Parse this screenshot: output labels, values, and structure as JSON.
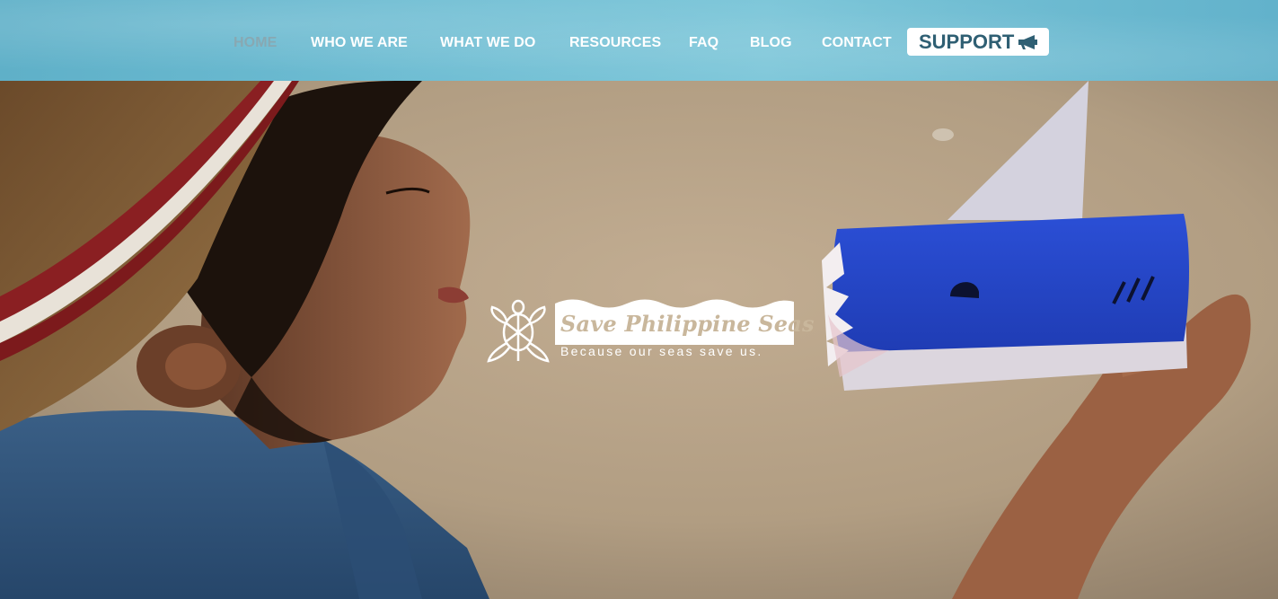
{
  "nav": {
    "items": [
      {
        "label": "HOME",
        "active": true
      },
      {
        "label": "WHO WE ARE",
        "active": false
      },
      {
        "label": "WHAT WE DO",
        "active": false
      },
      {
        "label": "RESOURCES",
        "active": false
      },
      {
        "label": "FAQ",
        "active": false
      },
      {
        "label": "BLOG",
        "active": false
      },
      {
        "label": "CONTACT",
        "active": false
      }
    ],
    "support_label": "SUPPORT",
    "support_icon": "megaphone-icon"
  },
  "logo": {
    "name": "Save Philippine Seas",
    "tagline": "Because our seas save us.",
    "icon": "turtle-icon"
  },
  "hero": {
    "image": "child-holding-paper-shark-toy"
  },
  "colors": {
    "header": "#6dbcd2",
    "nav_text": "#ffffff",
    "nav_active": "#88a8b2",
    "support_text": "#2f5f73"
  }
}
